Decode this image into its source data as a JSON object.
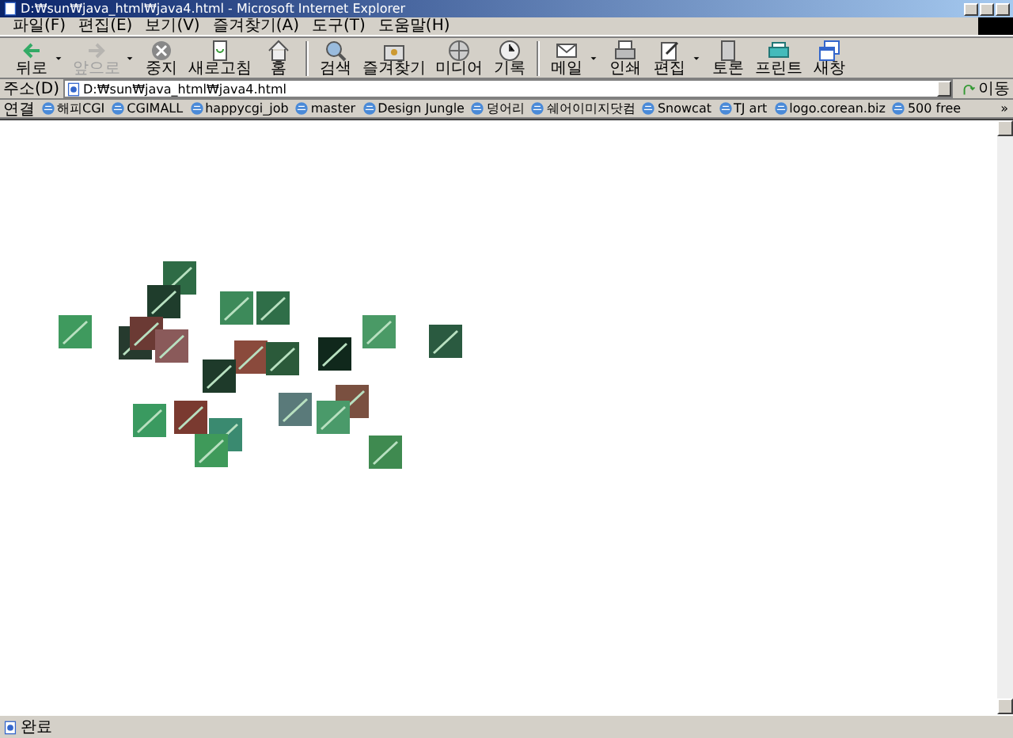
{
  "window": {
    "title": "D:₩sun₩java_html₩java4.html - Microsoft Internet Explorer"
  },
  "menu": [
    "파일(F)",
    "편집(E)",
    "보기(V)",
    "즐겨찾기(A)",
    "도구(T)",
    "도움말(H)"
  ],
  "toolbar": [
    [
      {
        "label": "뒤로",
        "disabled": false,
        "dropdown": true
      },
      {
        "label": "앞으로",
        "disabled": true,
        "dropdown": true
      },
      {
        "label": "중지",
        "disabled": false,
        "dropdown": false
      },
      {
        "label": "새로고침",
        "disabled": false,
        "dropdown": false
      },
      {
        "label": "홈",
        "disabled": false,
        "dropdown": false
      }
    ],
    [
      {
        "label": "검색",
        "disabled": false,
        "dropdown": false
      },
      {
        "label": "즐겨찾기",
        "disabled": false,
        "dropdown": false
      },
      {
        "label": "미디어",
        "disabled": false,
        "dropdown": false
      },
      {
        "label": "기록",
        "disabled": false,
        "dropdown": false
      }
    ],
    [
      {
        "label": "메일",
        "disabled": false,
        "dropdown": true
      },
      {
        "label": "인쇄",
        "disabled": false,
        "dropdown": false
      },
      {
        "label": "편집",
        "disabled": false,
        "dropdown": true
      },
      {
        "label": "토론",
        "disabled": false,
        "dropdown": false
      },
      {
        "label": "프린트",
        "disabled": false,
        "dropdown": false
      },
      {
        "label": "새창",
        "disabled": false,
        "dropdown": false
      }
    ]
  ],
  "address": {
    "label": "주소(D)",
    "value": "D:₩sun₩java_html₩java4.html",
    "go": "이동"
  },
  "links": {
    "label": "연결",
    "items": [
      "해피CGI",
      "CGIMALL",
      "happycgi_job",
      "master",
      "Design Jungle",
      "덩어리",
      "쉐어이미지닷컴",
      "Snowcat",
      "TJ art",
      "logo.corean.biz",
      "500 free"
    ],
    "more": "»"
  },
  "status_bar": {
    "text": "완료"
  }
}
